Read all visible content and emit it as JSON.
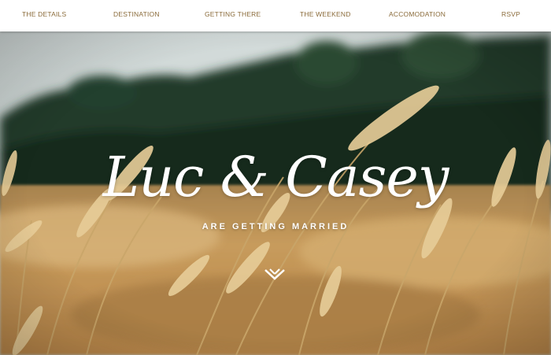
{
  "nav": {
    "items": [
      {
        "label": "THE DETAILS"
      },
      {
        "label": "DESTINATION"
      },
      {
        "label": "GETTING THERE"
      },
      {
        "label": "THE WEEKEND"
      },
      {
        "label": "ACCOMODATION"
      },
      {
        "label": "RSVP"
      }
    ]
  },
  "hero": {
    "names": "Luc & Casey",
    "tagline": "ARE GETTING MARRIED",
    "scroll_icon": "chevron-down-icon",
    "colors": {
      "sky": "#cdd6d6",
      "trees": "#1f3526",
      "field": "#c89d5e",
      "grass": "#e8cf9e",
      "nav_text": "#8a6b3a"
    }
  }
}
